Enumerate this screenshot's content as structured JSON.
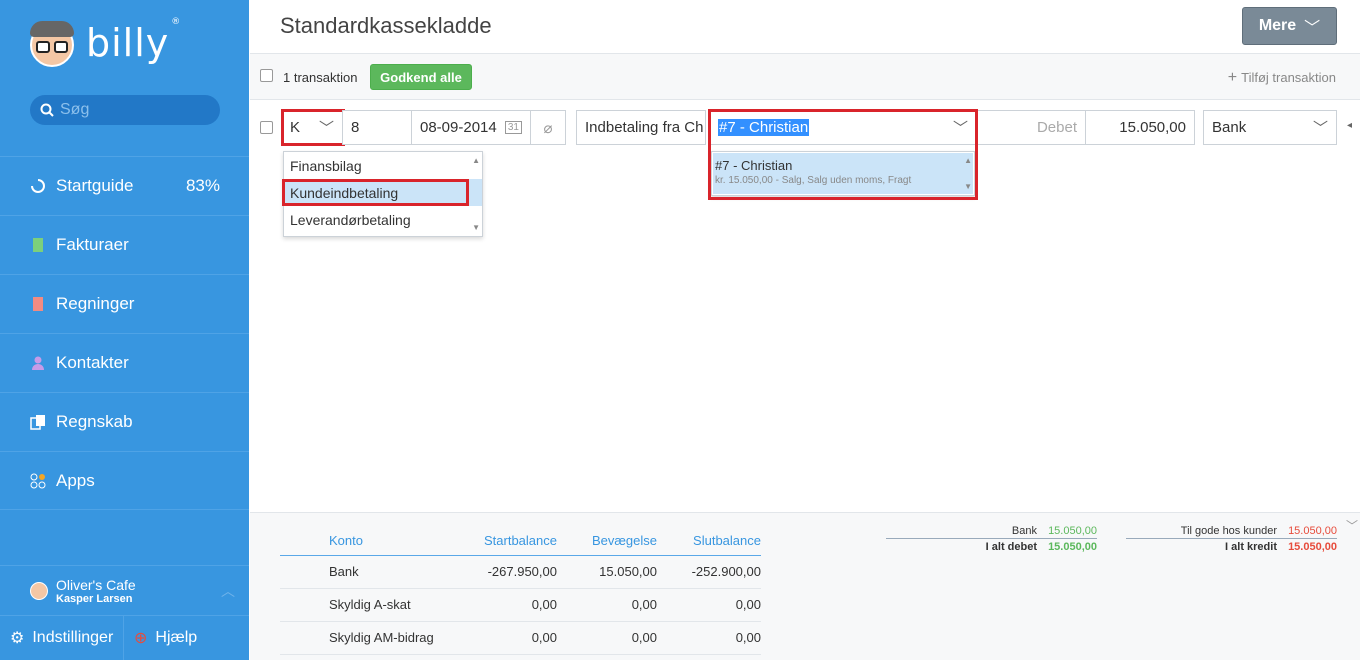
{
  "sidebar": {
    "logo": "billy",
    "logo_mark": "®",
    "search_placeholder": "Søg",
    "nav": [
      {
        "label": "Startguide",
        "extra": "83%",
        "icon": "progress-icon"
      },
      {
        "label": "Fakturaer",
        "icon": "invoice-icon"
      },
      {
        "label": "Regninger",
        "icon": "bill-icon"
      },
      {
        "label": "Kontakter",
        "icon": "contact-icon"
      },
      {
        "label": "Regnskab",
        "icon": "accounting-icon"
      },
      {
        "label": "Apps",
        "icon": "apps-icon"
      }
    ],
    "org_name": "Oliver's Cafe",
    "user_name": "Kasper Larsen",
    "settings": "Indstillinger",
    "help": "Hjælp"
  },
  "header": {
    "title": "Standardkassekladde",
    "more": "Mere"
  },
  "toolbar": {
    "count": "1 transaktion",
    "approve_all": "Godkend alle",
    "add": "Tilføj transaktion"
  },
  "transaction": {
    "type": "K",
    "number": "8",
    "date": "08-09-2014",
    "description": "Indbetaling fra Ch",
    "contact": "#7 - Christian",
    "side": "Debet",
    "amount": "15.050,00",
    "account": "Bank"
  },
  "type_options": [
    "Finansbilag",
    "Kundeindbetaling",
    "Leverandørbetaling"
  ],
  "contact_option": {
    "title": "#7 - Christian",
    "detail": "kr. 15.050,00 - Salg, Salg uden moms, Fragt"
  },
  "balance": {
    "headers": [
      "Konto",
      "Startbalance",
      "Bevægelse",
      "Slutbalance"
    ],
    "rows": [
      [
        "Bank",
        "-267.950,00",
        "15.050,00",
        "-252.900,00"
      ],
      [
        "Skyldig A-skat",
        "0,00",
        "0,00",
        "0,00"
      ],
      [
        "Skyldig AM-bidrag",
        "0,00",
        "0,00",
        "0,00"
      ]
    ]
  },
  "totals": {
    "debit_line": {
      "label": "Bank",
      "value": "15.050,00"
    },
    "debit_total": {
      "label": "I alt debet",
      "value": "15.050,00"
    },
    "credit_line": {
      "label": "Til gode hos kunder",
      "value": "15.050,00"
    },
    "credit_total": {
      "label": "I alt kredit",
      "value": "15.050,00"
    }
  },
  "colors": {
    "sidebar": "#3896e0",
    "green": "#5cb85c",
    "red": "#e74c3c",
    "highlight": "#d9242b"
  }
}
